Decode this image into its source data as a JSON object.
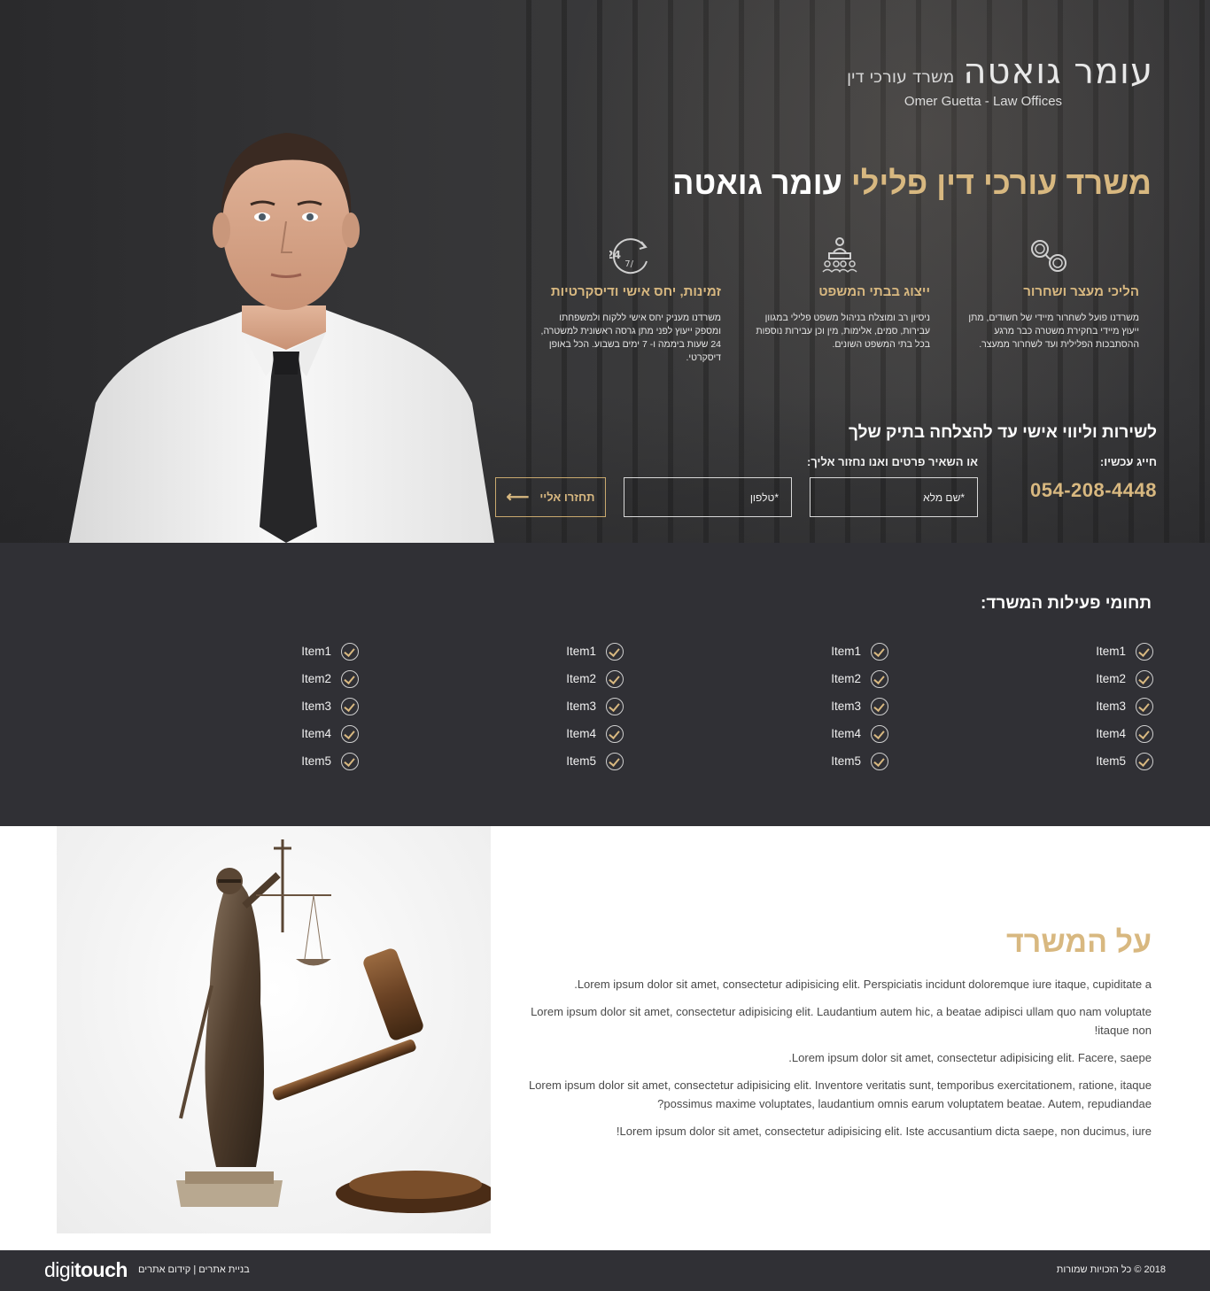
{
  "hero": {
    "logo_main": "עומר גואטה",
    "logo_sub": "משרד עורכי דין",
    "logo_en": "Omer Guetta - Law Offices",
    "headline_gold": "משרד עורכי דין פלילי",
    "headline_white": "עומר גואטה",
    "features": [
      {
        "icon": "handcuffs-icon",
        "title": "הליכי מעצר ושחרור",
        "desc": "משרדנו פועל לשחרור מיידי של חשודים, מתן ייעוץ מיידי בחקירת משטרה כבר מרגע ההסתבכות הפלילית ועד לשחרור ממעצר."
      },
      {
        "icon": "courtroom-icon",
        "title": "ייצוג בבתי המשפט",
        "desc": "ניסיון רב ומוצלח בניהול משפט פלילי במגוון עבירות, סמים, אלימות, מין וכן עבירות נוספות בכל בתי המשפט השונים."
      },
      {
        "icon": "clock-24-7-icon",
        "title": "זמינות, יחס אישי ודיסקרטיות",
        "desc": "משרדנו מעניק יחס אישי ללקוח ולמשפחתו ומספק ייעוץ לפני מתן גרסה ראשונית למשטרה, 24 שעות ביממה ו- 7 ימים בשבוע. הכל באופן דיסקרטי."
      }
    ],
    "service_title": "לשירות וליווי אישי עד להצלחה בתיק שלך",
    "call_label": "חייג עכשיו:",
    "phone": "054-208-4448",
    "or_label": "או השאיר פרטים ואנו נחזור אליך:",
    "name_placeholder": "*שם מלא",
    "phone_placeholder": "*טלפון",
    "cta_label": "תחזרו אליי"
  },
  "services": {
    "title": "תחומי פעילות המשרד:",
    "columns": [
      [
        "Item1",
        "Item2",
        "Item3",
        "Item4",
        "Item5"
      ],
      [
        "Item1",
        "Item2",
        "Item3",
        "Item4",
        "Item5"
      ],
      [
        "Item1",
        "Item2",
        "Item3",
        "Item4",
        "Item5"
      ],
      [
        "Item1",
        "Item2",
        "Item3",
        "Item4",
        "Item5"
      ]
    ]
  },
  "about": {
    "title": "על המשרד",
    "paragraphs": [
      "Lorem ipsum dolor sit amet, consectetur adipisicing elit. Perspiciatis incidunt doloremque iure itaque, cupiditate a.",
      "Lorem ipsum dolor sit amet, consectetur adipisicing elit. Laudantium autem hic, a beatae adipisci ullam quo nam voluptate itaque non!",
      "Lorem ipsum dolor sit amet, consectetur adipisicing elit. Facere, saepe.",
      "Lorem ipsum dolor sit amet, consectetur adipisicing elit. Inventore veritatis sunt, temporibus exercitationem, ratione, itaque possimus maxime voluptates, laudantium omnis earum voluptatem beatae. Autem, repudiandae?",
      "Lorem ipsum dolor sit amet, consectetur adipisicing elit. Iste accusantium dicta saepe, non ducimus, iure!"
    ]
  },
  "footer": {
    "logo_light": "digi",
    "logo_bold": "touch",
    "links": "בניית אתרים | קידום אתרים",
    "copyright": "2018 © כל הזכויות שמורות"
  },
  "colors": {
    "gold": "#d8b880",
    "dark": "#303035"
  }
}
